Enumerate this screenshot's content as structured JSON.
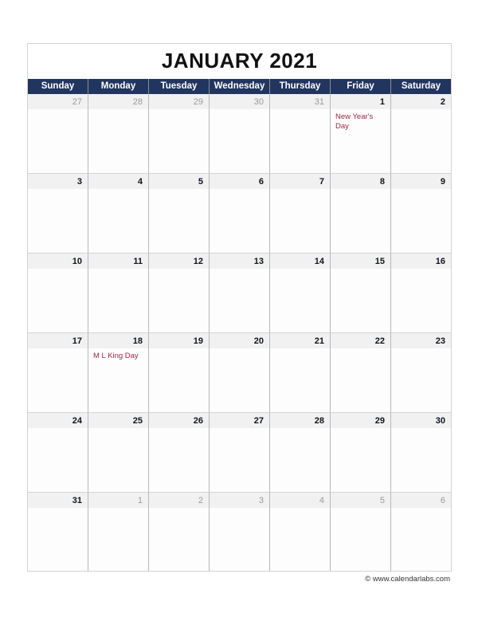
{
  "header": {
    "title": "JANUARY 2021"
  },
  "weekdays": [
    {
      "label": "Sunday"
    },
    {
      "label": "Monday"
    },
    {
      "label": "Tuesday"
    },
    {
      "label": "Wednesday"
    },
    {
      "label": "Thursday"
    },
    {
      "label": "Friday"
    },
    {
      "label": "Saturday"
    }
  ],
  "weeks": [
    {
      "days": [
        {
          "num": "27",
          "adjacent": true,
          "events": []
        },
        {
          "num": "28",
          "adjacent": true,
          "events": []
        },
        {
          "num": "29",
          "adjacent": true,
          "events": []
        },
        {
          "num": "30",
          "adjacent": true,
          "events": []
        },
        {
          "num": "31",
          "adjacent": true,
          "events": []
        },
        {
          "num": "1",
          "adjacent": false,
          "events": [
            "New Year's Day"
          ]
        },
        {
          "num": "2",
          "adjacent": false,
          "events": []
        }
      ]
    },
    {
      "days": [
        {
          "num": "3",
          "adjacent": false,
          "events": []
        },
        {
          "num": "4",
          "adjacent": false,
          "events": []
        },
        {
          "num": "5",
          "adjacent": false,
          "events": []
        },
        {
          "num": "6",
          "adjacent": false,
          "events": []
        },
        {
          "num": "7",
          "adjacent": false,
          "events": []
        },
        {
          "num": "8",
          "adjacent": false,
          "events": []
        },
        {
          "num": "9",
          "adjacent": false,
          "events": []
        }
      ]
    },
    {
      "days": [
        {
          "num": "10",
          "adjacent": false,
          "events": []
        },
        {
          "num": "11",
          "adjacent": false,
          "events": []
        },
        {
          "num": "12",
          "adjacent": false,
          "events": []
        },
        {
          "num": "13",
          "adjacent": false,
          "events": []
        },
        {
          "num": "14",
          "adjacent": false,
          "events": []
        },
        {
          "num": "15",
          "adjacent": false,
          "events": []
        },
        {
          "num": "16",
          "adjacent": false,
          "events": []
        }
      ]
    },
    {
      "days": [
        {
          "num": "17",
          "adjacent": false,
          "events": []
        },
        {
          "num": "18",
          "adjacent": false,
          "events": [
            "M L King Day"
          ]
        },
        {
          "num": "19",
          "adjacent": false,
          "events": []
        },
        {
          "num": "20",
          "adjacent": false,
          "events": []
        },
        {
          "num": "21",
          "adjacent": false,
          "events": []
        },
        {
          "num": "22",
          "adjacent": false,
          "events": []
        },
        {
          "num": "23",
          "adjacent": false,
          "events": []
        }
      ]
    },
    {
      "days": [
        {
          "num": "24",
          "adjacent": false,
          "events": []
        },
        {
          "num": "25",
          "adjacent": false,
          "events": []
        },
        {
          "num": "26",
          "adjacent": false,
          "events": []
        },
        {
          "num": "27",
          "adjacent": false,
          "events": []
        },
        {
          "num": "28",
          "adjacent": false,
          "events": []
        },
        {
          "num": "29",
          "adjacent": false,
          "events": []
        },
        {
          "num": "30",
          "adjacent": false,
          "events": []
        }
      ]
    },
    {
      "days": [
        {
          "num": "31",
          "adjacent": false,
          "events": []
        },
        {
          "num": "1",
          "adjacent": true,
          "events": []
        },
        {
          "num": "2",
          "adjacent": true,
          "events": []
        },
        {
          "num": "3",
          "adjacent": true,
          "events": []
        },
        {
          "num": "4",
          "adjacent": true,
          "events": []
        },
        {
          "num": "5",
          "adjacent": true,
          "events": []
        },
        {
          "num": "6",
          "adjacent": true,
          "events": []
        }
      ]
    }
  ],
  "footer": {
    "credit": "© www.calendarlabs.com"
  },
  "colors": {
    "header_navy": "#21355e",
    "event_red": "#9c2742",
    "day_band_gray": "#f1f1f1",
    "adjacent_day_gray": "#9a9a9a"
  }
}
